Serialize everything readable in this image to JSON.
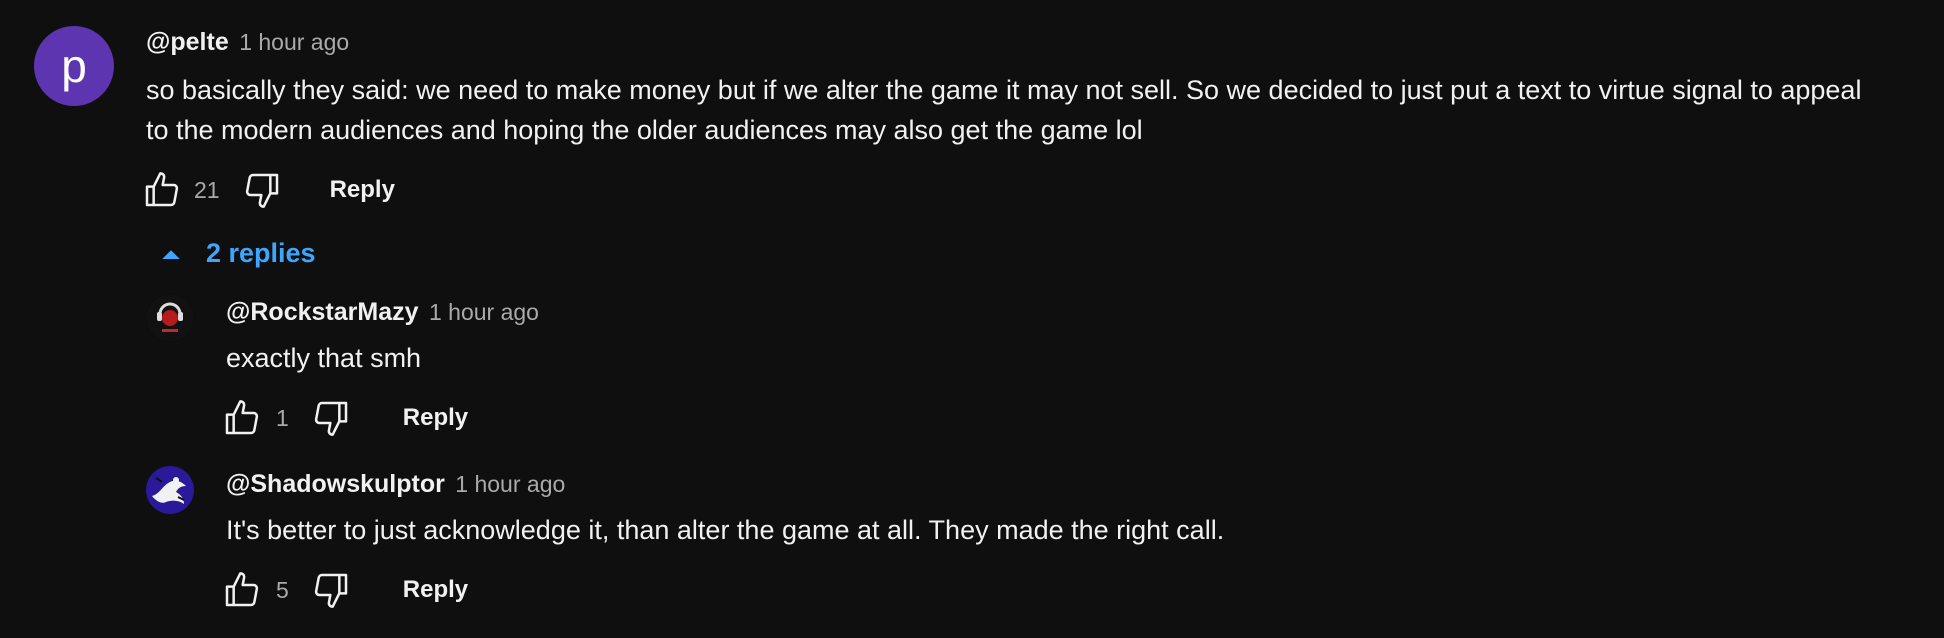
{
  "top_comment": {
    "avatar_letter": "p",
    "author": "@pelte",
    "time": "1 hour ago",
    "text": "so basically they said: we need to make money but if we alter the game it may not sell. So we decided to just put a text to virtue signal to appeal to the modern audiences and hoping the older audiences may also get the game lol",
    "likes": "21",
    "reply_label": "Reply"
  },
  "replies_toggle": {
    "label": "2 replies",
    "icon": "caret-up-icon",
    "color": "#3ea6ff"
  },
  "replies": [
    {
      "author": "@RockstarMazy",
      "time": "1 hour ago",
      "text": "exactly that smh",
      "likes": "1",
      "reply_label": "Reply"
    },
    {
      "author": "@Shadowskulptor",
      "time": "1 hour ago",
      "text": "It's better to just acknowledge it, than alter the game at all. They made the right call.",
      "likes": "5",
      "reply_label": "Reply"
    }
  ],
  "colors": {
    "background": "#0f0f0f",
    "text": "#f1f1f1",
    "muted": "#aaaaaa",
    "avatar_p": "#5e35b1",
    "link": "#3ea6ff"
  }
}
